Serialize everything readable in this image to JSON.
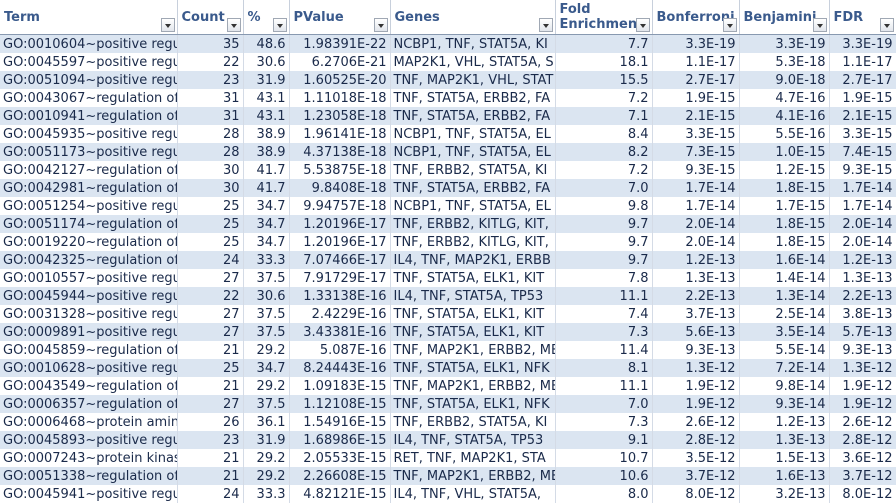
{
  "columns": [
    {
      "key": "term",
      "label": "Term"
    },
    {
      "key": "count",
      "label": "Count"
    },
    {
      "key": "pct",
      "label": "%"
    },
    {
      "key": "pvalue",
      "label": "PValue"
    },
    {
      "key": "genes",
      "label": "Genes"
    },
    {
      "key": "fold",
      "label": "Fold Enrichment"
    },
    {
      "key": "bonf",
      "label": "Bonferroni"
    },
    {
      "key": "benj",
      "label": "Benjamini"
    },
    {
      "key": "fdr",
      "label": "FDR"
    }
  ],
  "rows": [
    [
      "GO:0010604~positive regu",
      "35",
      "48.6",
      "1.98391E-22",
      "NCBP1, TNF, STAT5A, KI",
      "7.7",
      "3.3E-19",
      "3.3E-19",
      "3.3E-19"
    ],
    [
      "GO:0045597~positive regu",
      "22",
      "30.6",
      "6.2706E-21",
      "MAP2K1, VHL, STAT5A, S",
      "18.1",
      "1.1E-17",
      "5.3E-18",
      "1.1E-17"
    ],
    [
      "GO:0051094~positive regu",
      "23",
      "31.9",
      "1.60525E-20",
      "TNF, MAP2K1, VHL, STAT",
      "15.5",
      "2.7E-17",
      "9.0E-18",
      "2.7E-17"
    ],
    [
      "GO:0043067~regulation of",
      "31",
      "43.1",
      "1.11018E-18",
      "TNF, STAT5A, ERBB2, FA",
      "7.2",
      "1.9E-15",
      "4.7E-16",
      "1.9E-15"
    ],
    [
      "GO:0010941~regulation of",
      "31",
      "43.1",
      "1.23058E-18",
      "TNF, STAT5A, ERBB2, FA",
      "7.1",
      "2.1E-15",
      "4.1E-16",
      "2.1E-15"
    ],
    [
      "GO:0045935~positive regu",
      "28",
      "38.9",
      "1.96141E-18",
      "NCBP1, TNF, STAT5A, EL",
      "8.4",
      "3.3E-15",
      "5.5E-16",
      "3.3E-15"
    ],
    [
      "GO:0051173~positive regu",
      "28",
      "38.9",
      "4.37138E-18",
      "NCBP1, TNF, STAT5A, EL",
      "8.2",
      "7.3E-15",
      "1.0E-15",
      "7.4E-15"
    ],
    [
      "GO:0042127~regulation of",
      "30",
      "41.7",
      "5.53875E-18",
      "TNF, ERBB2, STAT5A, KI",
      "7.2",
      "9.3E-15",
      "1.2E-15",
      "9.3E-15"
    ],
    [
      "GO:0042981~regulation of",
      "30",
      "41.7",
      "9.8408E-18",
      "TNF, STAT5A, ERBB2, FA",
      "7.0",
      "1.7E-14",
      "1.8E-15",
      "1.7E-14"
    ],
    [
      "GO:0051254~positive regu",
      "25",
      "34.7",
      "9.94757E-18",
      "NCBP1, TNF, STAT5A, EL",
      "9.8",
      "1.7E-14",
      "1.7E-15",
      "1.7E-14"
    ],
    [
      "GO:0051174~regulation of",
      "25",
      "34.7",
      "1.20196E-17",
      "TNF, ERBB2, KITLG, KIT,",
      "9.7",
      "2.0E-14",
      "1.8E-15",
      "2.0E-14"
    ],
    [
      "GO:0019220~regulation of",
      "25",
      "34.7",
      "1.20196E-17",
      "TNF, ERBB2, KITLG, KIT,",
      "9.7",
      "2.0E-14",
      "1.8E-15",
      "2.0E-14"
    ],
    [
      "GO:0042325~regulation of",
      "24",
      "33.3",
      "7.07466E-17",
      "IL4, TNF, MAP2K1, ERBB",
      "9.7",
      "1.2E-13",
      "1.6E-14",
      "1.2E-13"
    ],
    [
      "GO:0010557~positive regu",
      "27",
      "37.5",
      "7.91729E-17",
      "TNF, STAT5A, ELK1, KIT",
      "7.8",
      "1.3E-13",
      "1.4E-14",
      "1.3E-13"
    ],
    [
      "GO:0045944~positive regu",
      "22",
      "30.6",
      "1.33138E-16",
      "IL4, TNF, STAT5A, TP53",
      "11.1",
      "2.2E-13",
      "1.3E-14",
      "2.2E-13"
    ],
    [
      "GO:0031328~positive regu",
      "27",
      "37.5",
      "2.4229E-16",
      "TNF, STAT5A, ELK1, KIT",
      "7.4",
      "3.7E-13",
      "2.5E-14",
      "3.8E-13"
    ],
    [
      "GO:0009891~positive regu",
      "27",
      "37.5",
      "3.43381E-16",
      "TNF, STAT5A, ELK1, KIT",
      "7.3",
      "5.6E-13",
      "3.5E-14",
      "5.7E-13"
    ],
    [
      "GO:0045859~regulation of",
      "21",
      "29.2",
      "5.087E-16",
      "TNF, MAP2K1, ERBB2, ME",
      "11.4",
      "9.3E-13",
      "5.5E-14",
      "9.3E-13"
    ],
    [
      "GO:0010628~positive regu",
      "25",
      "34.7",
      "8.24443E-16",
      "TNF, STAT5A, ELK1, NFK",
      "8.1",
      "1.3E-12",
      "7.2E-14",
      "1.3E-12"
    ],
    [
      "GO:0043549~regulation of",
      "21",
      "29.2",
      "1.09183E-15",
      "TNF, MAP2K1, ERBB2, ME",
      "11.1",
      "1.9E-12",
      "9.8E-14",
      "1.9E-12"
    ],
    [
      "GO:0006357~regulation of",
      "27",
      "37.5",
      "1.12108E-15",
      "TNF, STAT5A, ELK1, NFK",
      "7.0",
      "1.9E-12",
      "9.3E-14",
      "1.9E-12"
    ],
    [
      "GO:0006468~protein amin",
      "26",
      "36.1",
      "1.54916E-15",
      "TNF, ERBB2, STAT5A, KI",
      "7.3",
      "2.6E-12",
      "1.2E-13",
      "2.6E-12"
    ],
    [
      "GO:0045893~positive regu",
      "23",
      "31.9",
      "1.68986E-15",
      "IL4, TNF, STAT5A, TP53",
      "9.1",
      "2.8E-12",
      "1.3E-13",
      "2.8E-12"
    ],
    [
      "GO:0007243~protein kinas",
      "21",
      "29.2",
      "2.05533E-15",
      "RET, TNF, MAP2K1, STA",
      "10.7",
      "3.5E-12",
      "1.5E-13",
      "3.6E-12"
    ],
    [
      "GO:0051338~regulation of",
      "21",
      "29.2",
      "2.26608E-15",
      "TNF, MAP2K1, ERBB2, ME",
      "10.6",
      "3.7E-12",
      "1.6E-13",
      "3.7E-12"
    ],
    [
      "GO:0045941~positive regu",
      "24",
      "33.3",
      "4.82121E-15",
      "IL4, TNF, VHL, STAT5A,",
      "8.0",
      "8.0E-12",
      "3.2E-13",
      "8.0E-12"
    ]
  ]
}
